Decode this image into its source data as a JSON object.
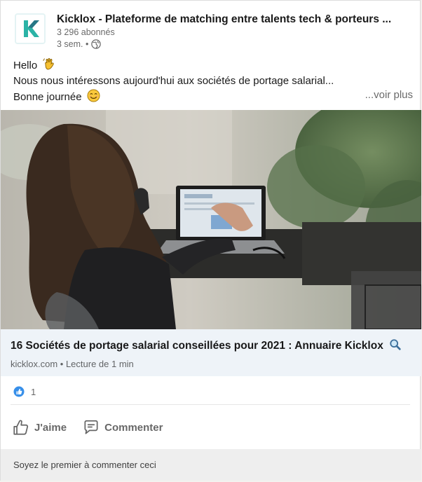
{
  "post": {
    "author": {
      "name": "Kicklox - Plateforme de matching entre talents tech & porteurs ...",
      "followers": "3 296 abonnés",
      "time": "3 sem. •",
      "logo_letter": "K",
      "logo_color": "#2bb3a6"
    },
    "text": {
      "line1": "Hello",
      "line2": "Nous nous intéressons aujourd'hui aux sociétés de portage salarial...",
      "line3": "Bonne journée",
      "see_more": "...voir plus"
    },
    "link": {
      "title": "16 Sociétés de portage salarial conseillées pour 2021 : Annuaire Kicklox",
      "meta": "kicklox.com • Lecture de 1 min"
    },
    "reactions": {
      "count": "1",
      "icon": "like-icon",
      "color": "#378fe9"
    },
    "actions": {
      "like": "J'aime",
      "comment": "Commenter"
    },
    "comment_prompt": "Soyez le premier à commenter ceci"
  }
}
